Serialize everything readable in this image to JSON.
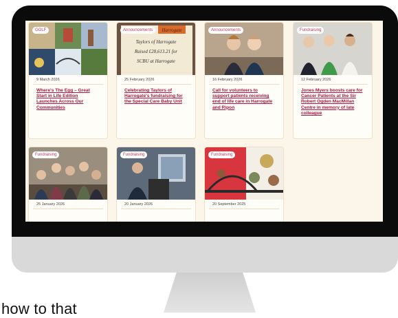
{
  "caption": "how to that",
  "cards": [
    {
      "tag": "GOLF",
      "date": "9 March 2026",
      "title": "Where's The Egg – Great Start in Life Edition Launches Across Our Communities"
    },
    {
      "tag": "Announcements",
      "date": "25 February 2026",
      "title": "Celebrating Taylors of Harrogate's fundraising for the Special Care Baby Unit"
    },
    {
      "tag": "Announcements",
      "date": "16 February 2026",
      "title": "Call for volunteers to support patients receiving end of life care in Harrogate and Ripon"
    },
    {
      "tag": "Fundraising",
      "date": "12 February 2026",
      "title": "Jones Myers boosts care for Cancer Patients at the Sir Robert Ogden MacMillan Centre in memory of late colleague"
    },
    {
      "tag": "Fundraising",
      "date": "25 January 2026",
      "title": ""
    },
    {
      "tag": "Fundraising",
      "date": "20 January 2026",
      "title": ""
    },
    {
      "tag": "Fundraising",
      "date": "20 September 2025",
      "title": ""
    }
  ],
  "board": {
    "line1": "Harrogate",
    "line2": "Taylors of Harrogate",
    "line3": "Raised £28,613.21 for",
    "line4": "SCBU at Harrogate"
  },
  "colors": {
    "accent": "#a8163f",
    "tag_text": "#c13a5c",
    "page_bg": "#fbf5ea",
    "bezel": "#0b0b0b"
  }
}
